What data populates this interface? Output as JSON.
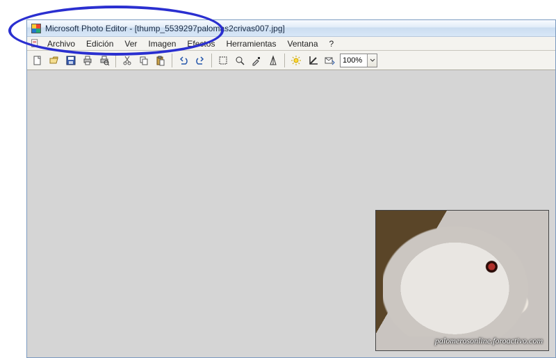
{
  "title": {
    "app_name": "Microsoft Photo Editor",
    "document": "[thump_5539297palomas2crivas007.jpg]",
    "full": "Microsoft Photo Editor - [thump_5539297palomas2crivas007.jpg]"
  },
  "menu": {
    "items": [
      "Archivo",
      "Edición",
      "Ver",
      "Imagen",
      "Efectos",
      "Herramientas",
      "Ventana",
      "?"
    ]
  },
  "toolbar": {
    "buttons": [
      {
        "name": "new-icon"
      },
      {
        "name": "open-icon"
      },
      {
        "name": "save-icon"
      },
      {
        "name": "print-icon"
      },
      {
        "name": "print-preview-icon"
      },
      {
        "sep": true
      },
      {
        "name": "cut-icon"
      },
      {
        "name": "copy-icon"
      },
      {
        "name": "paste-icon"
      },
      {
        "sep": true
      },
      {
        "name": "undo-icon"
      },
      {
        "name": "redo-icon"
      },
      {
        "sep": true
      },
      {
        "name": "select-rect-icon"
      },
      {
        "name": "zoom-icon"
      },
      {
        "name": "eyedropper-icon"
      },
      {
        "name": "sharpen-icon"
      },
      {
        "sep": true
      },
      {
        "name": "brightness-icon"
      },
      {
        "name": "crop-icon"
      },
      {
        "name": "send-icon"
      }
    ],
    "zoom_value": "100%"
  },
  "image": {
    "watermark": "palomerosonline.foroactivo.com"
  },
  "annotation": {
    "shape": "ellipse",
    "color": "#2a2fd0"
  }
}
